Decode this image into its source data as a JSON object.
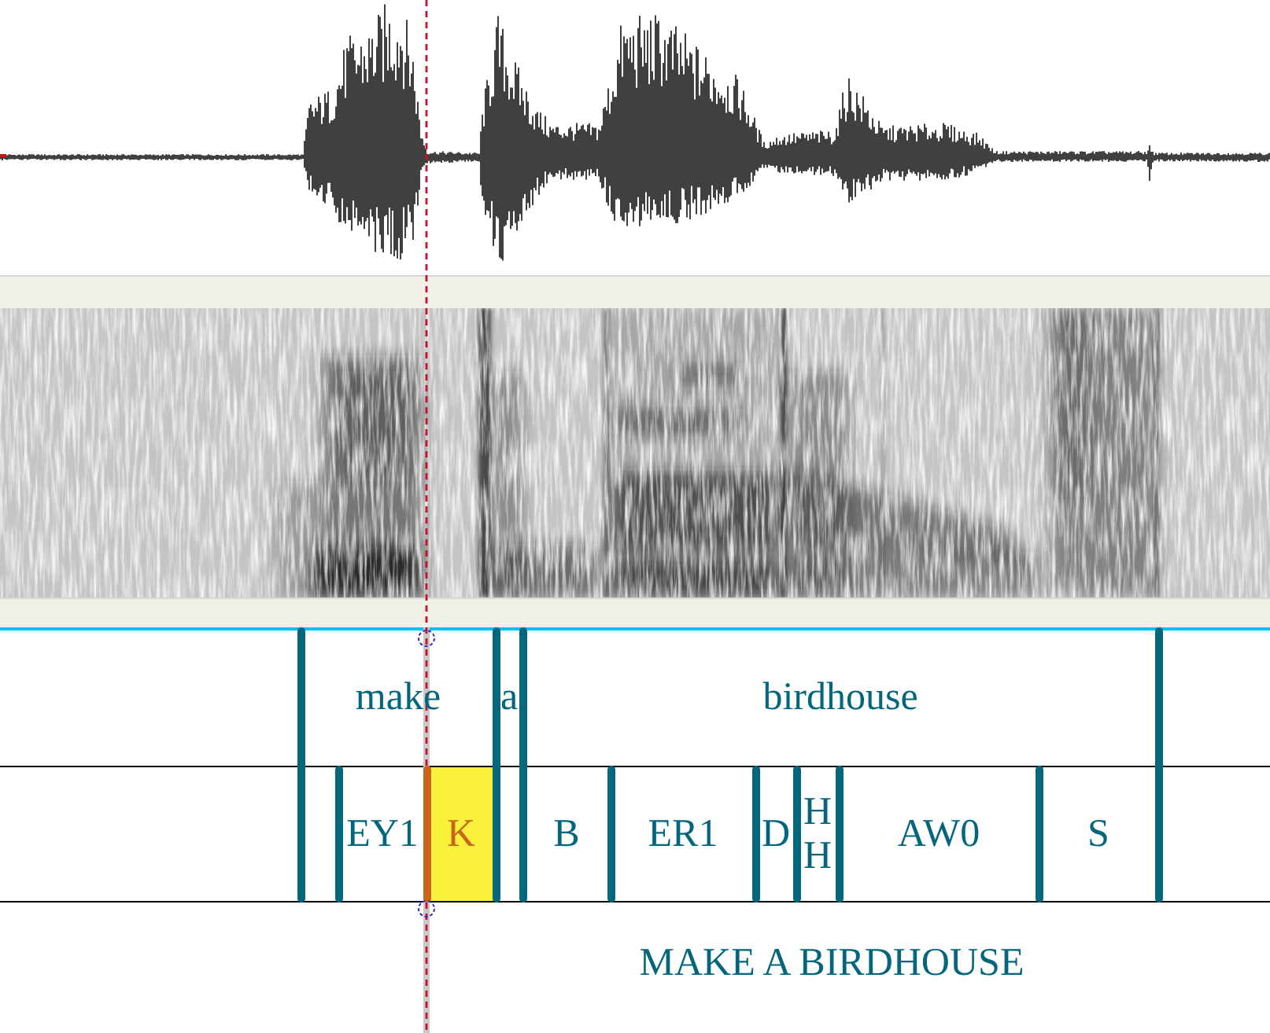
{
  "word_tier": {
    "intervals": [
      {
        "text": "make",
        "selected": false
      },
      {
        "text": "a",
        "selected": false
      },
      {
        "text": "birdhouse",
        "selected": false
      }
    ]
  },
  "phone_tier": {
    "intervals": [
      {
        "text": "EY1",
        "selected": false
      },
      {
        "text": "K",
        "selected": true
      },
      {
        "text": "B",
        "selected": false
      },
      {
        "text": "ER1",
        "selected": false
      },
      {
        "text": "D",
        "selected": false
      },
      {
        "text": "HH",
        "selected": false
      },
      {
        "text": "AW0",
        "selected": false
      },
      {
        "text": "S",
        "selected": false
      }
    ]
  },
  "transcript": {
    "text": "MAKE A BIRDHOUSE"
  }
}
